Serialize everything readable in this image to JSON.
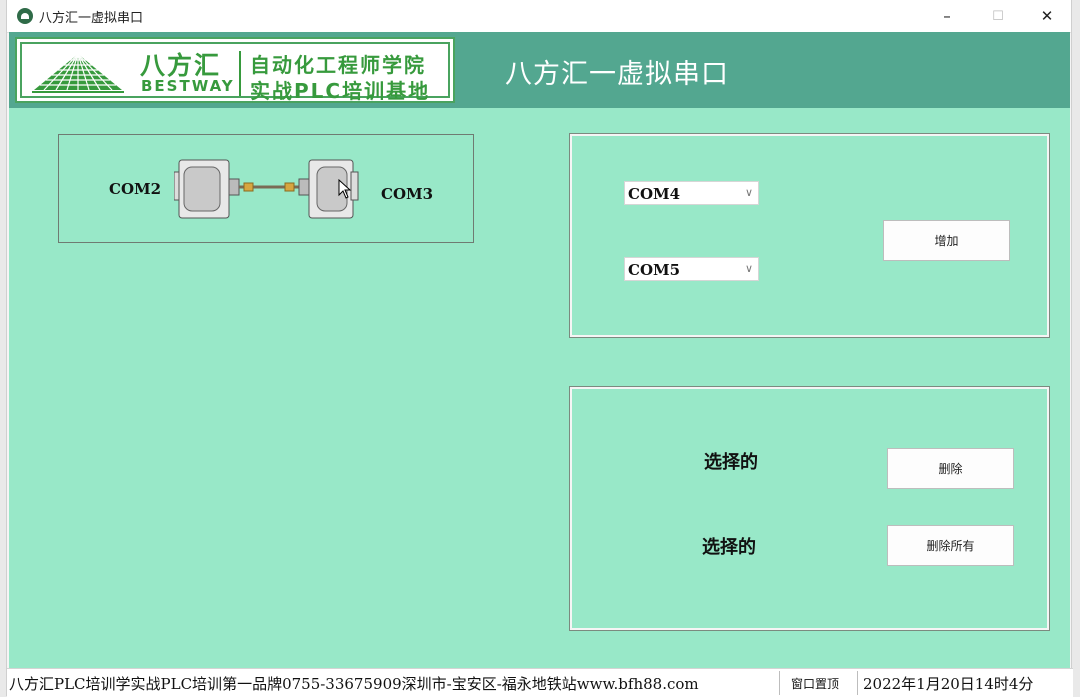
{
  "window": {
    "title": "八方汇一虚拟串口",
    "controls": {
      "minimize": "–",
      "maximize": "☐",
      "close": "✕"
    }
  },
  "header": {
    "logo": {
      "brand_cn": "八方汇",
      "brand_en": "BESTWAY",
      "line1": "自动化工程师学院",
      "line2": "实战PLC培训基地"
    },
    "app_title": "八方汇一虚拟串口"
  },
  "connection": {
    "left_port": "COM2",
    "right_port": "COM3"
  },
  "add_panel": {
    "port_a": "COM4",
    "port_b": "COM5",
    "add_button": "增加"
  },
  "delete_panel": {
    "selected_label_1": "选择的",
    "delete_button": "删除",
    "selected_label_2": "选择的",
    "delete_all_button": "删除所有"
  },
  "statusbar": {
    "info": "八方汇PLC培训学实战PLC培训第一品牌0755-33675909深圳市-宝安区-福永地铁站www.bfh88.com",
    "pin_window": "窗口置顶",
    "datetime": "2022年1月20日14时4分"
  },
  "colors": {
    "header_bg": "#53a790",
    "main_bg": "#98e8c8",
    "logo_green": "#379a3d"
  }
}
